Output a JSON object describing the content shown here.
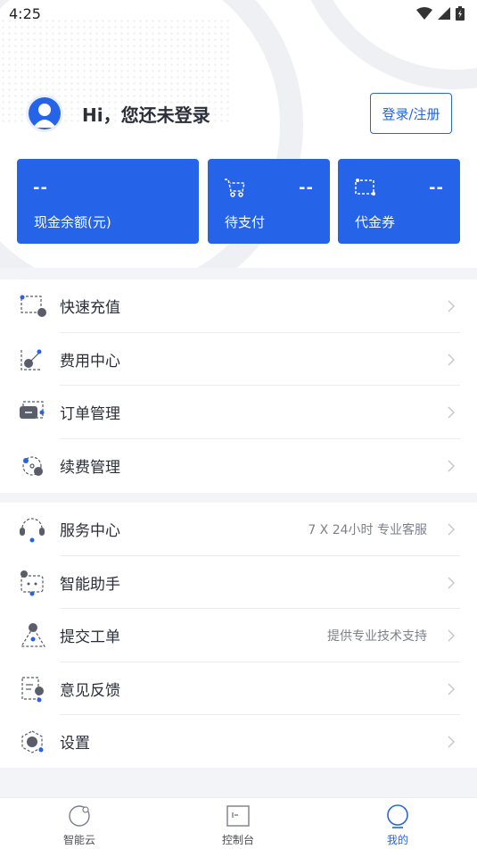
{
  "status_bar": {
    "time": "4:25"
  },
  "header": {
    "greeting": "Hi，您还未登录",
    "login_button": "登录/注册"
  },
  "cards": {
    "cash": {
      "value": "--",
      "label": "现金余额(元)"
    },
    "pending_payment": {
      "value": "--",
      "label": "待支付"
    },
    "voucher": {
      "value": "--",
      "label": "代金券"
    }
  },
  "menu_group_1": [
    {
      "label": "快速充值",
      "icon": "recharge-icon"
    },
    {
      "label": "费用中心",
      "icon": "cost-chart-icon"
    },
    {
      "label": "订单管理",
      "icon": "order-icon"
    },
    {
      "label": "续费管理",
      "icon": "renew-icon"
    }
  ],
  "menu_group_2": [
    {
      "label": "服务中心",
      "desc": "7 X 24小时 专业客服",
      "icon": "headset-icon"
    },
    {
      "label": "智能助手",
      "icon": "robot-icon"
    },
    {
      "label": "提交工单",
      "desc": "提供专业技术支持",
      "icon": "ticket-icon"
    },
    {
      "label": "意见反馈",
      "icon": "feedback-icon"
    },
    {
      "label": "设置",
      "icon": "settings-icon"
    }
  ],
  "bottom_nav": [
    {
      "label": "智能云",
      "icon": "cloud-icon"
    },
    {
      "label": "控制台",
      "icon": "console-icon"
    },
    {
      "label": "我的",
      "icon": "profile-icon",
      "active": true
    }
  ],
  "colors": {
    "accent": "#2563e8",
    "text": "#2b2f3a",
    "muted": "#7c808a"
  }
}
